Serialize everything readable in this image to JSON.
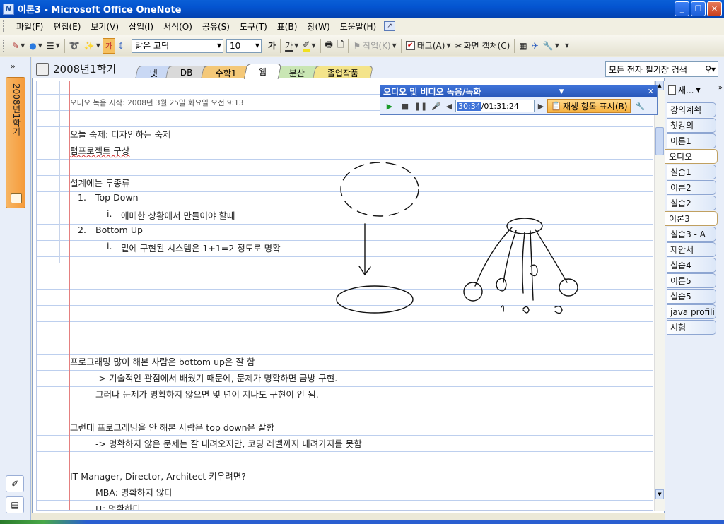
{
  "window": {
    "title": "이론3 - Microsoft Office OneNote",
    "app_icon": "N"
  },
  "menu": [
    "파일(F)",
    "편집(E)",
    "보기(V)",
    "삽입(I)",
    "서식(O)",
    "공유(S)",
    "도구(T)",
    "표(B)",
    "창(W)",
    "도움말(H)"
  ],
  "toolbar": {
    "font_name": "맑은 고딕",
    "font_size": "10",
    "bold_glyph": "가",
    "highlight_glyph": "가",
    "font_color_glyph": "가",
    "task_label": "작업(K)",
    "tag_label": "태그(A)",
    "screen_clip_label": "화면 캡처(C)"
  },
  "notebook": {
    "title": "2008년1학기",
    "sidebar_label": "2008년1학기",
    "sections": [
      {
        "label": "넷",
        "color": "#c9d8f4"
      },
      {
        "label": "DB",
        "color": "#d9d9d9"
      },
      {
        "label": "수학1",
        "color": "#f4c878"
      },
      {
        "label": "웹",
        "color": "#ffffff",
        "active": true
      },
      {
        "label": "분산",
        "color": "#c9e6b4"
      },
      {
        "label": "졸업작품",
        "color": "#f4e48a"
      }
    ],
    "search_placeholder": "모든 전자 필기장 검색"
  },
  "audio": {
    "title": "오디오 및 비디오 녹음/녹화",
    "time_current": "30:34",
    "time_separator": "/",
    "time_total": "01:31:24",
    "playlist_label": "재생 항목 표시(B)"
  },
  "page": {
    "meta": "오디오 녹음 시작: 2008년 3월 25일 화요일 오전 9:13",
    "lines": {
      "homework": "오늘 숙제: 디자인하는 숙제",
      "termproject": "텀프로젝트 구상",
      "design_types": "설계에는 두종류",
      "item1_num": "1.",
      "item1": "Top Down",
      "item1a_num": "i.",
      "item1a": "애매한 상황에서 만들어야 할때",
      "item2_num": "2.",
      "item2": "Bottom Up",
      "item2a_num": "i.",
      "item2a": "밑에 구현된 시스템은 1+1=2 정도로 명확",
      "p1": "프로그래밍 많이 해본 사람은 bottom up은 잘 함",
      "p2": "-> 기술적인 관점에서 배웠기 때문에, 문제가 명확하면 금방 구현.",
      "p3": "그러나 문제가 명확하지 않으면 몇 년이 지나도 구현이 안 됨.",
      "p4": "그런데 프로그래밍을 안 해본 사람은 top down은 잘함",
      "p5": "-> 명확하지 않은 문제는 잘 내려오지만, 코딩 레벨까지 내려가지를 못함",
      "p6": "IT Manager, Director, Architect 키우려면?",
      "p7": "MBA: 명확하지 않다",
      "p8": "IT: 명확하다"
    }
  },
  "pages": [
    "새...",
    "강의계획",
    "첫강의",
    "이론1",
    "오디오",
    "실습1",
    "이론2",
    "실습2",
    "이론3",
    "실습3 - A",
    "제안서",
    "실습4",
    "이론5",
    "실습5",
    "java profili",
    "시험"
  ]
}
